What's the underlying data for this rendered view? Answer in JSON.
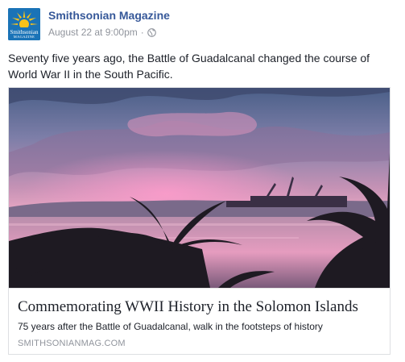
{
  "post": {
    "page_name": "Smithsonian Magazine",
    "timestamp": "August 22 at 9:00pm",
    "separator": "·",
    "privacy_icon": "globe-icon",
    "text": "Seventy five years ago, the Battle of Guadalcanal changed the course of World War II in the South Pacific.",
    "avatar": {
      "line1": "Smithsonian",
      "line2": "MAGAZINE",
      "icon": "sun-logo-icon",
      "bg_color": "#1a73b7",
      "sun_color": "#f7c21a"
    }
  },
  "link_card": {
    "image_alt": "Pink sunset over harbor with palm trees and cranes",
    "title": "Commemorating WWII History in the Solomon Islands",
    "description": "75 years after the Battle of Guadalcanal, walk in the footsteps of history",
    "domain": "SMITHSONIANMAG.COM"
  },
  "colors": {
    "link_blue": "#365899",
    "meta_gray": "#90949c",
    "text": "#1d2129",
    "border": "#dddfe2"
  }
}
